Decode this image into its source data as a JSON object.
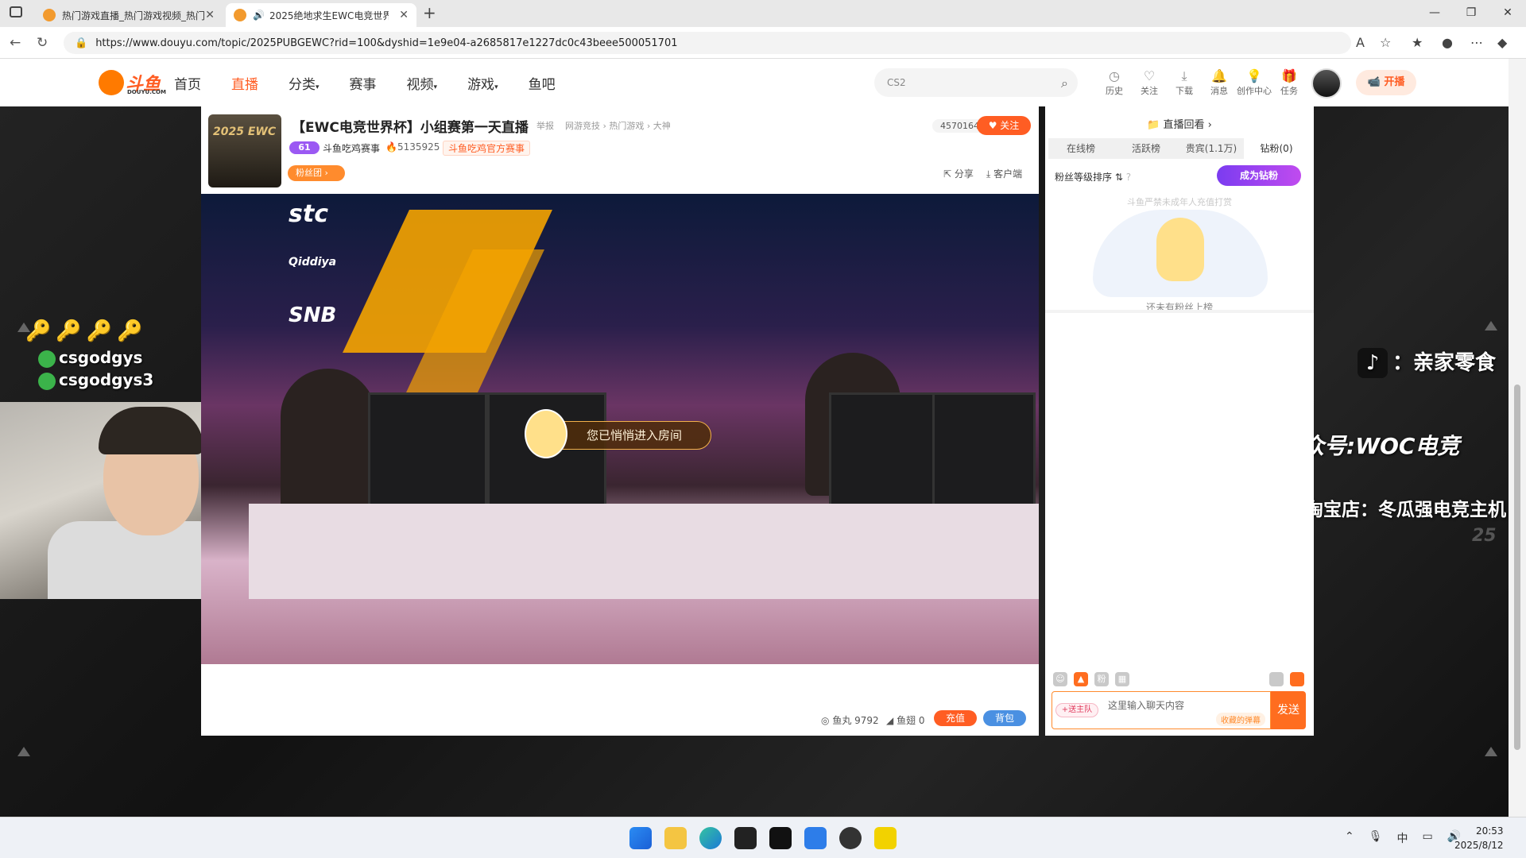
{
  "browser": {
    "tabs": [
      {
        "title": "热门游戏直播_热门游戏视频_热门",
        "active": false
      },
      {
        "title": "2025绝地求生EWC电竞世界",
        "active": true
      }
    ],
    "new_tab": "+",
    "window_controls": [
      "—",
      "❐",
      "✕"
    ],
    "url": "https://www.douyu.com/topic/2025PUBGEWC?rid=100&dyshid=1e9e04-a2685817e1227dc0c43beee500051701"
  },
  "site": {
    "logo_text": "斗鱼",
    "logo_sub": "DOUYU.COM",
    "nav": [
      {
        "label": "首页",
        "active": false
      },
      {
        "label": "直播",
        "active": true
      },
      {
        "label": "分类",
        "active": false,
        "dropdown": true
      },
      {
        "label": "赛事",
        "active": false
      },
      {
        "label": "视频",
        "active": false,
        "dropdown": true
      },
      {
        "label": "游戏",
        "active": false,
        "dropdown": true
      },
      {
        "label": "鱼吧",
        "active": false
      }
    ],
    "search_placeholder": "CS2",
    "header_icons": [
      {
        "label": "历史",
        "icon": "clock-icon"
      },
      {
        "label": "关注",
        "icon": "heart-icon"
      },
      {
        "label": "下载",
        "icon": "download-icon"
      },
      {
        "label": "消息",
        "icon": "bell-icon"
      },
      {
        "label": "创作中心",
        "icon": "bulb-icon"
      },
      {
        "label": "任务",
        "icon": "gift-icon"
      }
    ],
    "open_button": "开播"
  },
  "room": {
    "thumb_text": "2025 EWC",
    "title": "【EWC电竞世界杯】小组赛第一天直播",
    "report": "举报",
    "breadcrumb": "网游竞技 › 热门游戏 › 大神",
    "level": "61",
    "anchor": "斗鱼吃鸡赛事",
    "heat": "5135925",
    "official_tag": "斗鱼吃鸡官方赛事",
    "fan_club": "粉丝团",
    "viewers": "4570164",
    "follow": "关注",
    "share": "分享",
    "client": "客户端",
    "enter_toast": "您已悄悄进入房间",
    "fish_ball_label": "鱼丸",
    "fish_ball": "9792",
    "fish_wing_label": "鱼翅",
    "fish_wing": "0",
    "recharge": "充值",
    "backpack": "背包"
  },
  "overlay": {
    "wechat1": "csgodgys",
    "wechat2": "csgodgys3",
    "tiktok": "：亲家零食",
    "woc": "公众号:WOC电竞",
    "taobao": "淘宝店：冬瓜强电竞主机",
    "number": "25"
  },
  "video_sponsors": [
    "stc",
    "Qiddiya",
    "SNB"
  ],
  "chat": {
    "replay": "直播回看 ›",
    "tabs": [
      {
        "label": "在线榜",
        "active": false
      },
      {
        "label": "活跃榜",
        "active": false
      },
      {
        "label": "贵宾(1.1万)",
        "active": false
      },
      {
        "label": "钻粉(0)",
        "active": true
      }
    ],
    "fan_sort": "粉丝等级排序 ⇅",
    "become_fan": "成为钻粉",
    "minor_note": "斗鱼严禁未成年人充值打赏",
    "empty_hint": "还未有粉丝上榜",
    "input_tag": "+送主队",
    "input_placeholder": "这里输入聊天内容",
    "collect_barrage": "收藏的弹幕",
    "send": "发送"
  },
  "taskbar": {
    "ime": "中",
    "time": "20:53",
    "date": "2025/8/12"
  }
}
